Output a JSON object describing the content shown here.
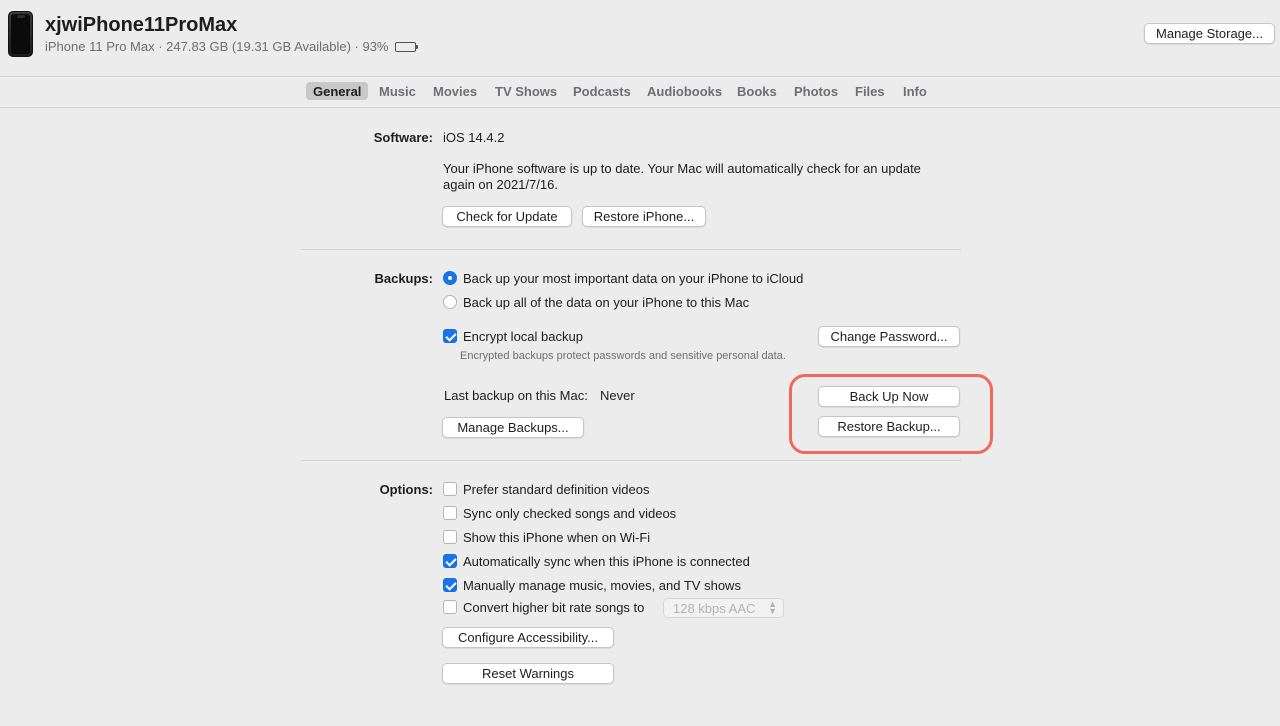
{
  "device": {
    "name": "xjwiPhone11ProMax",
    "subtitle": "iPhone 11 Pro Max · 247.83 GB (19.31 GB Available) · 93%",
    "battery_level": 0.93,
    "battery_color": "#31c23a"
  },
  "header": {
    "manage_storage_label": "Manage Storage..."
  },
  "tabs": [
    {
      "label": "General",
      "active": true
    },
    {
      "label": "Music"
    },
    {
      "label": "Movies"
    },
    {
      "label": "TV Shows"
    },
    {
      "label": "Podcasts"
    },
    {
      "label": "Audiobooks"
    },
    {
      "label": "Books"
    },
    {
      "label": "Photos"
    },
    {
      "label": "Files"
    },
    {
      "label": "Info"
    }
  ],
  "software": {
    "label": "Software:",
    "version": "iOS 14.4.2",
    "status_line1": "Your iPhone software is up to date. Your Mac will automatically check for an update",
    "status_line2": "again on 2021/7/16.",
    "check_update_label": "Check for Update",
    "restore_iphone_label": "Restore iPhone..."
  },
  "backups": {
    "label": "Backups:",
    "option_icloud": "Back up your most important data on your iPhone to iCloud",
    "option_mac": "Back up all of the data on your iPhone to this Mac",
    "selected": "icloud",
    "encrypt_label": "Encrypt local backup",
    "encrypt_checked": true,
    "encrypt_note": "Encrypted backups protect passwords and sensitive personal data.",
    "change_password_label": "Change Password...",
    "last_backup_label": "Last backup on this Mac:",
    "last_backup_value": "Never",
    "back_up_now_label": "Back Up Now",
    "restore_backup_label": "Restore Backup...",
    "manage_backups_label": "Manage Backups...",
    "highlight_color": "#ee6a5a"
  },
  "options": {
    "label": "Options:",
    "items": [
      {
        "label": "Prefer standard definition videos",
        "checked": false
      },
      {
        "label": "Sync only checked songs and videos",
        "checked": false
      },
      {
        "label": "Show this iPhone when on Wi-Fi",
        "checked": false
      },
      {
        "label": "Automatically sync when this iPhone is connected",
        "checked": true
      },
      {
        "label": "Manually manage music, movies, and TV shows",
        "checked": true
      },
      {
        "label": "Convert higher bit rate songs to",
        "checked": false
      }
    ],
    "bitrate_value": "128 kbps AAC",
    "configure_accessibility_label": "Configure Accessibility...",
    "reset_warnings_label": "Reset Warnings"
  },
  "colors": {
    "accent": "#1a73e8",
    "background": "#ececec"
  }
}
